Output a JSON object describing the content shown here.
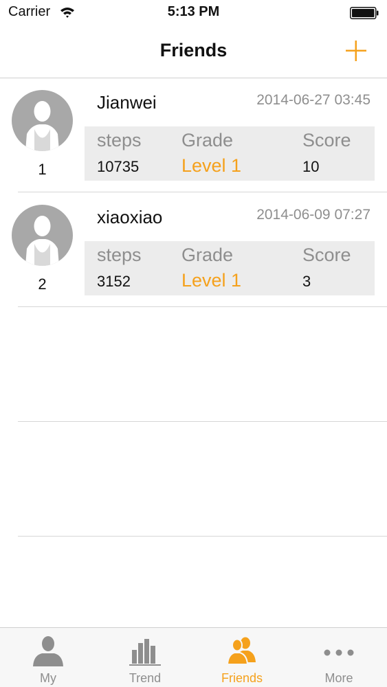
{
  "status_bar": {
    "carrier": "Carrier",
    "time": "5:13 PM"
  },
  "nav": {
    "title": "Friends",
    "add_icon": "plus-icon"
  },
  "friends": [
    {
      "rank": "1",
      "name": "Jianwei",
      "timestamp": "2014-06-27 03:45",
      "steps_label": "steps",
      "steps": "10735",
      "grade_label": "Grade",
      "grade": "Level 1",
      "score_label": "Score",
      "score": "10"
    },
    {
      "rank": "2",
      "name": "xiaoxiao",
      "timestamp": "2014-06-09 07:27",
      "steps_label": "steps",
      "steps": "3152",
      "grade_label": "Grade",
      "grade": "Level 1",
      "score_label": "Score",
      "score": "3"
    }
  ],
  "tabs": [
    {
      "label": "My",
      "icon": "person-icon"
    },
    {
      "label": "Trend",
      "icon": "bar-chart-icon"
    },
    {
      "label": "Friends",
      "icon": "friends-icon",
      "active": true
    },
    {
      "label": "More",
      "icon": "more-dots-icon"
    }
  ],
  "colors": {
    "accent": "#f5a11c",
    "muted_text": "#8e8e8e",
    "stats_bg": "#ececec",
    "avatar_bg": "#a8a8a8"
  }
}
